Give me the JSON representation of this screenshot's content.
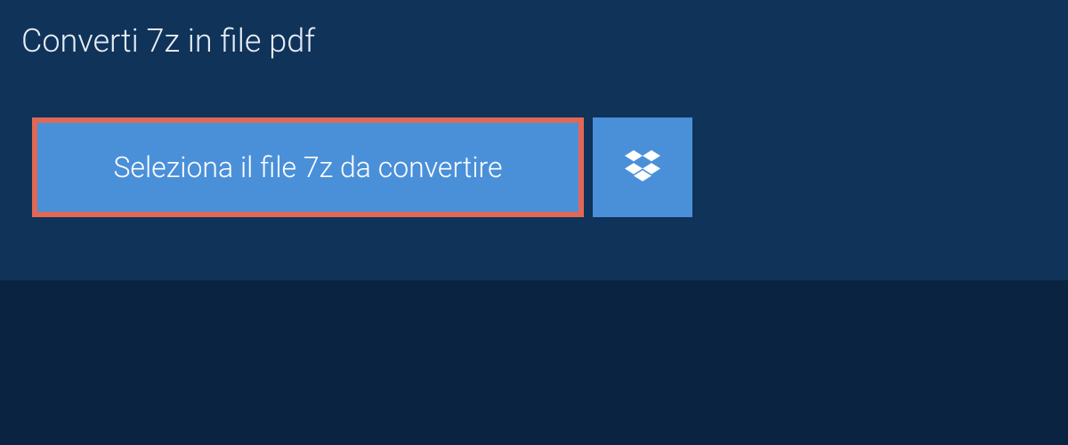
{
  "header": {
    "title": "Converti 7z in file pdf"
  },
  "upload": {
    "select_button_label": "Seleziona il file 7z da convertire"
  },
  "colors": {
    "background_dark": "#0a2340",
    "background_panel": "#10335a",
    "button_blue": "#4a90d9",
    "highlight_border": "#e16856"
  }
}
